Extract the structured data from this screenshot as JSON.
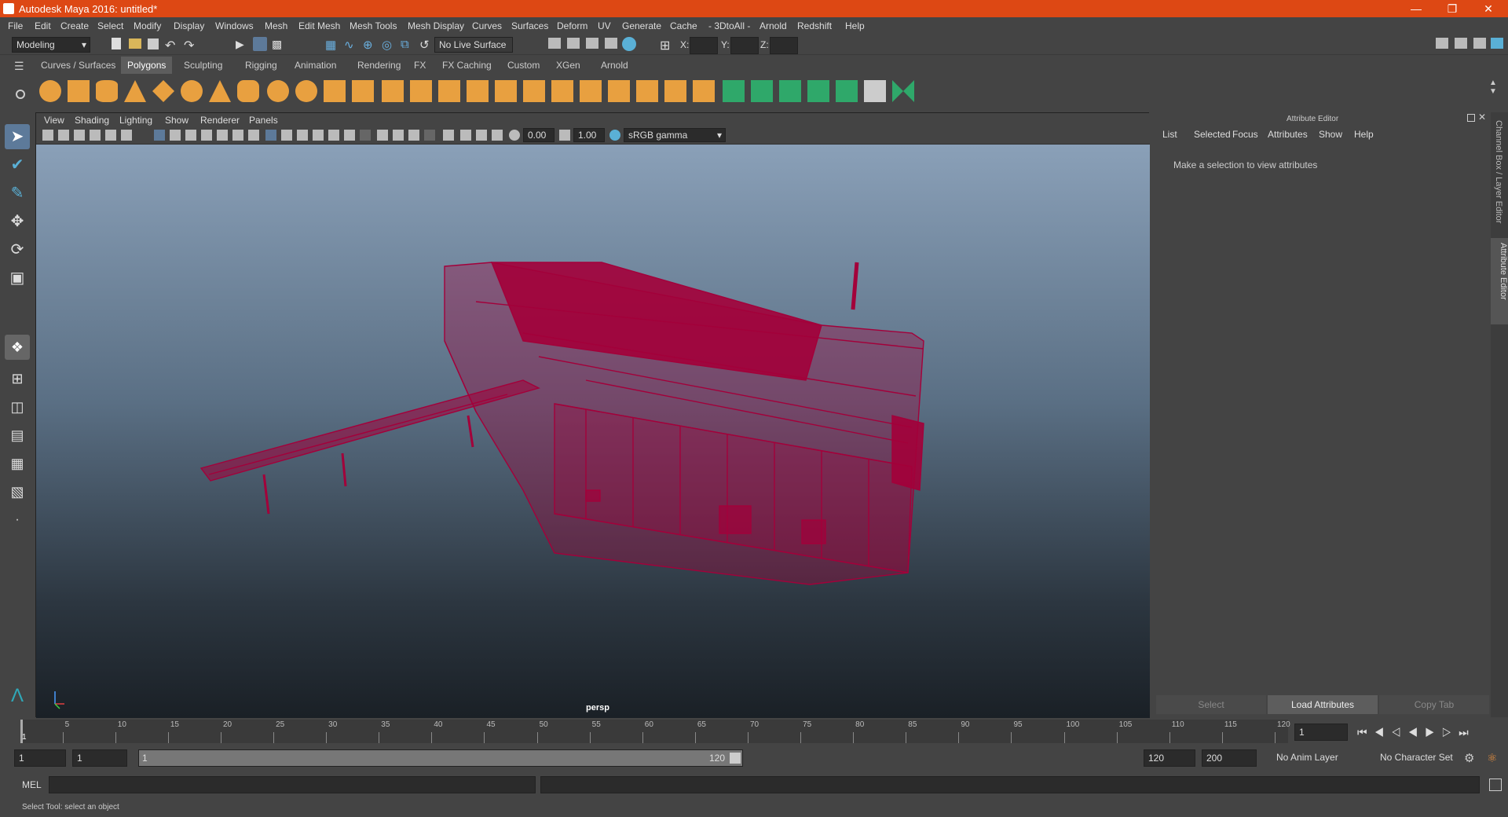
{
  "window": {
    "title": "Autodesk Maya 2016: untitled*"
  },
  "menubar": [
    "File",
    "Edit",
    "Create",
    "Select",
    "Modify",
    "Display",
    "Windows",
    "Mesh",
    "Edit Mesh",
    "Mesh Tools",
    "Mesh Display",
    "Curves",
    "Surfaces",
    "Deform",
    "UV",
    "Generate",
    "Cache",
    "- 3DtoAll -",
    "Arnold",
    "Redshift",
    "Help"
  ],
  "statusline": {
    "mode": "Modeling",
    "live_surface": "No Live Surface",
    "x_label": "X:",
    "y_label": "Y:",
    "z_label": "Z:"
  },
  "shelf_tabs": [
    "Curves / Surfaces",
    "Polygons",
    "Sculpting",
    "Rigging",
    "Animation",
    "Rendering",
    "FX",
    "FX Caching",
    "Custom",
    "XGen",
    "Arnold"
  ],
  "shelf_active": "Polygons",
  "viewport": {
    "menu": [
      "View",
      "Shading",
      "Lighting",
      "Show",
      "Renderer",
      "Panels"
    ],
    "exposure": "0.00",
    "gamma": "1.00",
    "color_space": "sRGB gamma",
    "camera": "persp"
  },
  "attribute_editor": {
    "title": "Attribute Editor",
    "menu": [
      "List",
      "Selected",
      "Focus",
      "Attributes",
      "Show",
      "Help"
    ],
    "message": "Make a selection to view attributes",
    "select_label": "Select",
    "load_label": "Load Attributes",
    "copy_label": "Copy Tab"
  },
  "right_tabs": {
    "channel_box": "Channel Box / Layer Editor",
    "attribute_editor": "Attribute Editor"
  },
  "timeline": {
    "ticks": [
      "5",
      "10",
      "15",
      "20",
      "25",
      "30",
      "35",
      "40",
      "45",
      "50",
      "55",
      "60",
      "65",
      "70",
      "75",
      "80",
      "85",
      "90",
      "95",
      "100",
      "105",
      "110",
      "115",
      "120"
    ],
    "start_label": "1",
    "current_frame": "1"
  },
  "range": {
    "start": "1",
    "playback_start": "1",
    "slider_start": "1",
    "slider_end": "120",
    "playback_end": "120",
    "end": "200",
    "anim_layer": "No Anim Layer",
    "char_set": "No Character Set"
  },
  "command": {
    "label": "MEL"
  },
  "help": {
    "text": "Select Tool: select an object"
  },
  "colors": {
    "title_bg": "#dd4814",
    "wireframe": "#a3003a",
    "shelf_icon": "#e8a040",
    "accent": "#5ab0d6"
  }
}
